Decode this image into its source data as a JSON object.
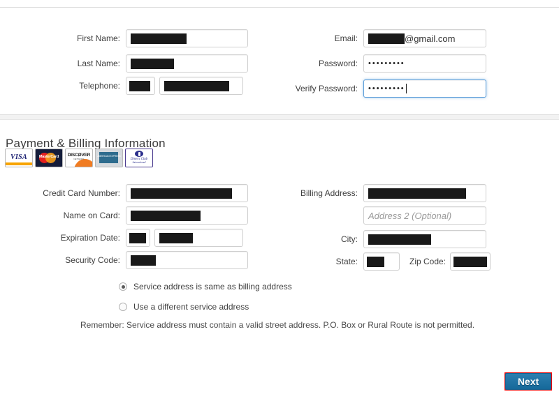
{
  "colors": {
    "accent": "#1a6f9e",
    "highlight_box": "#ff0000",
    "focus_border": "#5b9dd9",
    "label_text": "#3f3f3f",
    "redaction": "#191919"
  },
  "account_section": {
    "left_fields": [
      {
        "label": "First Name:",
        "value": "",
        "redacted": true,
        "redact_width": 80
      },
      {
        "label": "Last Name:",
        "value": "",
        "redacted": true,
        "redact_width": 62
      },
      {
        "label": "Telephone:",
        "value": "",
        "redacted": true,
        "redact_width": 30
      }
    ],
    "telephone_second_value": "",
    "right_fields": [
      {
        "label": "Email:",
        "value": "@gmail.com",
        "redacted": true,
        "redact_width": 52
      },
      {
        "label": "Password:",
        "value": "•••••••••",
        "redacted": false
      },
      {
        "label": "Verify Password:",
        "value": "•••••••••",
        "redacted": false,
        "focused": true
      }
    ]
  },
  "payment_section": {
    "heading": "Payment & Billing Information",
    "accepted_cards": [
      {
        "name": "visa",
        "label": "VISA"
      },
      {
        "name": "mastercard",
        "label": "MasterCard"
      },
      {
        "name": "discover",
        "label": "DISCØVER",
        "sublabel": "NETWORK"
      },
      {
        "name": "american-express",
        "label": "AMERICAN EXPRESS"
      },
      {
        "name": "diners-club",
        "label": "Diners Club",
        "sublabel": "International"
      }
    ],
    "left_fields": [
      {
        "label": "Credit Card Number:",
        "value": "",
        "redacted": true,
        "redact_width": 145
      },
      {
        "label": "Name on Card:",
        "value": "",
        "redacted": true,
        "redact_width": 100
      },
      {
        "label": "Expiration Date:",
        "value": "",
        "redacted": true,
        "redact_width": 24
      },
      {
        "label": "Security Code:",
        "value": "",
        "redacted": true,
        "redact_width": 36
      }
    ],
    "expiration_year_value": "",
    "right_fields": [
      {
        "label": "Billing Address:",
        "value": "",
        "redacted": true,
        "redact_width": 140
      },
      {
        "label": "",
        "value": "",
        "placeholder": "Address 2 (Optional)"
      },
      {
        "label": "City:",
        "value": "",
        "redacted": true,
        "redact_width": 90
      },
      {
        "label": "State:",
        "value": "",
        "redacted": true,
        "redact_width": 25
      }
    ],
    "zip_label": "Zip Code:",
    "zip_value": ""
  },
  "service_address": {
    "options": [
      {
        "label": "Service address is same as billing address",
        "selected": true
      },
      {
        "label": "Use a different service address",
        "selected": false
      }
    ],
    "note": "Remember: Service address must contain a valid street address. P.O. Box or Rural Route is not permitted."
  },
  "footer": {
    "next_label": "Next"
  }
}
